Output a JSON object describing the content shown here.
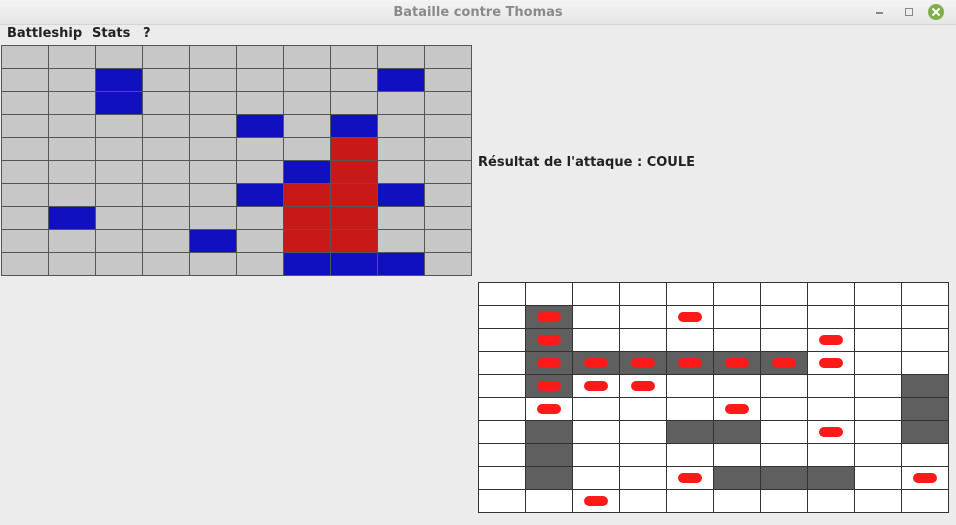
{
  "window": {
    "title": "Bataille contre Thomas"
  },
  "menu": {
    "items": [
      "Battleship",
      "Stats",
      "?"
    ]
  },
  "status": {
    "attack_result": "Résultat de l'attaque : COULE"
  },
  "colors": {
    "water": "#c7c7c7",
    "ship": "#1010c0",
    "ship_hit": "#c81818",
    "unknown": "#ffffff",
    "sunk_ship": "#5f5f5f",
    "marker": "#ff1a1a"
  },
  "own_board": {
    "legend": {
      ".": "water",
      "S": "ship",
      "H": "ship_hit"
    },
    "rows": [
      "..........",
      "..S.....S.",
      "..S.......",
      ".....S.S..",
      ".......H..",
      "......SH..",
      ".....SHHS.",
      ".S....HH..",
      "....S.HH..",
      "......SSS."
    ]
  },
  "enemy_board": {
    "legend": {
      ".": "unknown",
      "G": "sunk_ship",
      "*": "shot_marker",
      "X": "sunk_ship_with_marker"
    },
    "rows": [
      "..........",
      ".X..*.....",
      ".X.....*..",
      ".XXXXXX*..",
      ".X**.....G",
      ".*...*...G",
      ".G..GG.*.G",
      ".G........",
      ".G..*GGG.*",
      "..*......."
    ]
  }
}
